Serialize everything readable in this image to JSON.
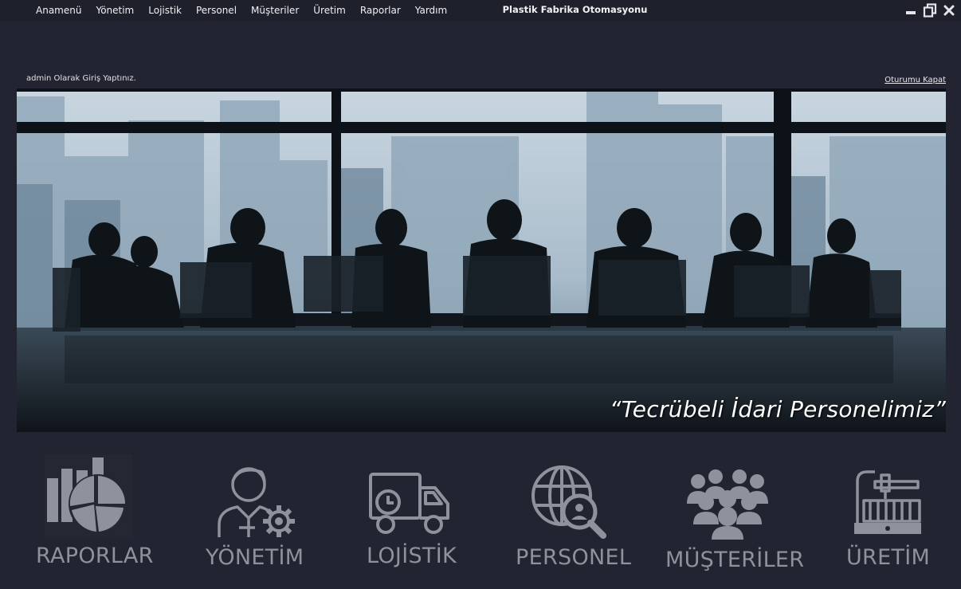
{
  "menu": {
    "items": [
      {
        "label": "Anamenü"
      },
      {
        "label": "Yönetim"
      },
      {
        "label": "Lojistik"
      },
      {
        "label": "Personel"
      },
      {
        "label": "Müşteriler"
      },
      {
        "label": "Üretim"
      },
      {
        "label": "Raporlar"
      },
      {
        "label": "Yardım"
      }
    ]
  },
  "window": {
    "title": "Plastik Fabrika Otomasyonu",
    "controls": [
      "minimize-icon",
      "restore-icon",
      "close-icon"
    ]
  },
  "session": {
    "login_status": "admin Olarak Giriş Yaptınız.",
    "logout_label": "Oturumu Kapat"
  },
  "banner": {
    "caption": "“Tecrübeli İdari Personelimiz”"
  },
  "modules": [
    {
      "label": "RAPORLAR",
      "icon": "reports-chart-icon"
    },
    {
      "label": "YÖNETİM",
      "icon": "manager-gear-icon"
    },
    {
      "label": "LOJİSTİK",
      "icon": "delivery-truck-icon"
    },
    {
      "label": "PERSONEL",
      "icon": "globe-person-search-icon"
    },
    {
      "label": "MÜŞTERİLER",
      "icon": "customer-group-icon"
    },
    {
      "label": "ÜRETİM",
      "icon": "cnc-machine-icon"
    }
  ],
  "colors": {
    "background": "#222431",
    "topbar": "#1e202c",
    "tile_gray": "#8f929c"
  }
}
